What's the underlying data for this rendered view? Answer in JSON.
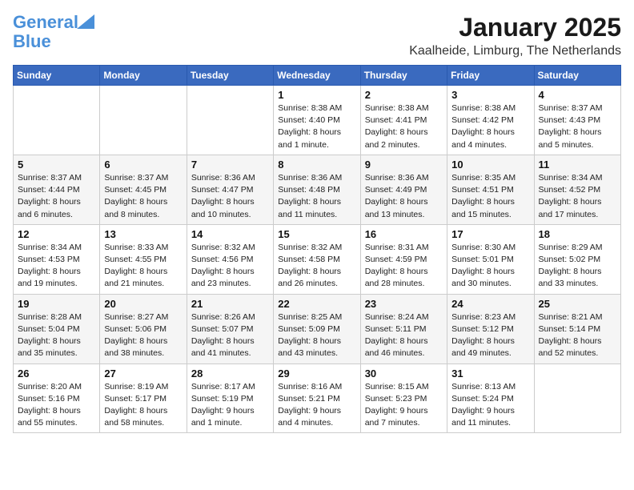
{
  "header": {
    "logo_line1": "General",
    "logo_line2": "Blue",
    "main_title": "January 2025",
    "subtitle": "Kaalheide, Limburg, The Netherlands"
  },
  "days_of_week": [
    "Sunday",
    "Monday",
    "Tuesday",
    "Wednesday",
    "Thursday",
    "Friday",
    "Saturday"
  ],
  "weeks": [
    [
      {
        "day": "",
        "info": ""
      },
      {
        "day": "",
        "info": ""
      },
      {
        "day": "",
        "info": ""
      },
      {
        "day": "1",
        "info": "Sunrise: 8:38 AM\nSunset: 4:40 PM\nDaylight: 8 hours\nand 1 minute."
      },
      {
        "day": "2",
        "info": "Sunrise: 8:38 AM\nSunset: 4:41 PM\nDaylight: 8 hours\nand 2 minutes."
      },
      {
        "day": "3",
        "info": "Sunrise: 8:38 AM\nSunset: 4:42 PM\nDaylight: 8 hours\nand 4 minutes."
      },
      {
        "day": "4",
        "info": "Sunrise: 8:37 AM\nSunset: 4:43 PM\nDaylight: 8 hours\nand 5 minutes."
      }
    ],
    [
      {
        "day": "5",
        "info": "Sunrise: 8:37 AM\nSunset: 4:44 PM\nDaylight: 8 hours\nand 6 minutes."
      },
      {
        "day": "6",
        "info": "Sunrise: 8:37 AM\nSunset: 4:45 PM\nDaylight: 8 hours\nand 8 minutes."
      },
      {
        "day": "7",
        "info": "Sunrise: 8:36 AM\nSunset: 4:47 PM\nDaylight: 8 hours\nand 10 minutes."
      },
      {
        "day": "8",
        "info": "Sunrise: 8:36 AM\nSunset: 4:48 PM\nDaylight: 8 hours\nand 11 minutes."
      },
      {
        "day": "9",
        "info": "Sunrise: 8:36 AM\nSunset: 4:49 PM\nDaylight: 8 hours\nand 13 minutes."
      },
      {
        "day": "10",
        "info": "Sunrise: 8:35 AM\nSunset: 4:51 PM\nDaylight: 8 hours\nand 15 minutes."
      },
      {
        "day": "11",
        "info": "Sunrise: 8:34 AM\nSunset: 4:52 PM\nDaylight: 8 hours\nand 17 minutes."
      }
    ],
    [
      {
        "day": "12",
        "info": "Sunrise: 8:34 AM\nSunset: 4:53 PM\nDaylight: 8 hours\nand 19 minutes."
      },
      {
        "day": "13",
        "info": "Sunrise: 8:33 AM\nSunset: 4:55 PM\nDaylight: 8 hours\nand 21 minutes."
      },
      {
        "day": "14",
        "info": "Sunrise: 8:32 AM\nSunset: 4:56 PM\nDaylight: 8 hours\nand 23 minutes."
      },
      {
        "day": "15",
        "info": "Sunrise: 8:32 AM\nSunset: 4:58 PM\nDaylight: 8 hours\nand 26 minutes."
      },
      {
        "day": "16",
        "info": "Sunrise: 8:31 AM\nSunset: 4:59 PM\nDaylight: 8 hours\nand 28 minutes."
      },
      {
        "day": "17",
        "info": "Sunrise: 8:30 AM\nSunset: 5:01 PM\nDaylight: 8 hours\nand 30 minutes."
      },
      {
        "day": "18",
        "info": "Sunrise: 8:29 AM\nSunset: 5:02 PM\nDaylight: 8 hours\nand 33 minutes."
      }
    ],
    [
      {
        "day": "19",
        "info": "Sunrise: 8:28 AM\nSunset: 5:04 PM\nDaylight: 8 hours\nand 35 minutes."
      },
      {
        "day": "20",
        "info": "Sunrise: 8:27 AM\nSunset: 5:06 PM\nDaylight: 8 hours\nand 38 minutes."
      },
      {
        "day": "21",
        "info": "Sunrise: 8:26 AM\nSunset: 5:07 PM\nDaylight: 8 hours\nand 41 minutes."
      },
      {
        "day": "22",
        "info": "Sunrise: 8:25 AM\nSunset: 5:09 PM\nDaylight: 8 hours\nand 43 minutes."
      },
      {
        "day": "23",
        "info": "Sunrise: 8:24 AM\nSunset: 5:11 PM\nDaylight: 8 hours\nand 46 minutes."
      },
      {
        "day": "24",
        "info": "Sunrise: 8:23 AM\nSunset: 5:12 PM\nDaylight: 8 hours\nand 49 minutes."
      },
      {
        "day": "25",
        "info": "Sunrise: 8:21 AM\nSunset: 5:14 PM\nDaylight: 8 hours\nand 52 minutes."
      }
    ],
    [
      {
        "day": "26",
        "info": "Sunrise: 8:20 AM\nSunset: 5:16 PM\nDaylight: 8 hours\nand 55 minutes."
      },
      {
        "day": "27",
        "info": "Sunrise: 8:19 AM\nSunset: 5:17 PM\nDaylight: 8 hours\nand 58 minutes."
      },
      {
        "day": "28",
        "info": "Sunrise: 8:17 AM\nSunset: 5:19 PM\nDaylight: 9 hours\nand 1 minute."
      },
      {
        "day": "29",
        "info": "Sunrise: 8:16 AM\nSunset: 5:21 PM\nDaylight: 9 hours\nand 4 minutes."
      },
      {
        "day": "30",
        "info": "Sunrise: 8:15 AM\nSunset: 5:23 PM\nDaylight: 9 hours\nand 7 minutes."
      },
      {
        "day": "31",
        "info": "Sunrise: 8:13 AM\nSunset: 5:24 PM\nDaylight: 9 hours\nand 11 minutes."
      },
      {
        "day": "",
        "info": ""
      }
    ]
  ]
}
